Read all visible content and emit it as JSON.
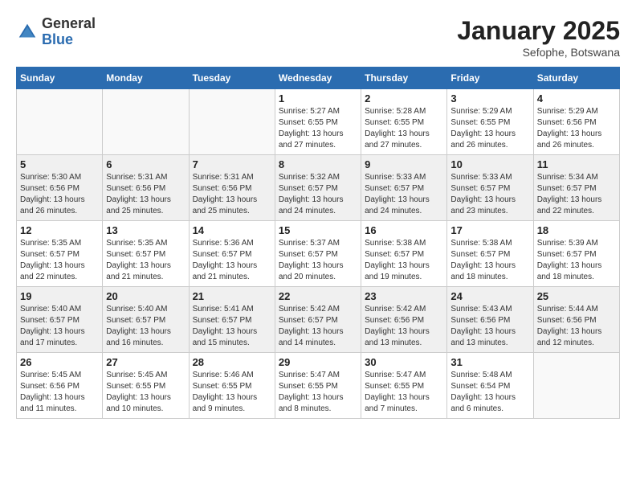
{
  "header": {
    "logo_general": "General",
    "logo_blue": "Blue",
    "month_title": "January 2025",
    "subtitle": "Sefophe, Botswana"
  },
  "weekdays": [
    "Sunday",
    "Monday",
    "Tuesday",
    "Wednesday",
    "Thursday",
    "Friday",
    "Saturday"
  ],
  "weeks": [
    [
      {
        "day": "",
        "info": ""
      },
      {
        "day": "",
        "info": ""
      },
      {
        "day": "",
        "info": ""
      },
      {
        "day": "1",
        "info": "Sunrise: 5:27 AM\nSunset: 6:55 PM\nDaylight: 13 hours\nand 27 minutes."
      },
      {
        "day": "2",
        "info": "Sunrise: 5:28 AM\nSunset: 6:55 PM\nDaylight: 13 hours\nand 27 minutes."
      },
      {
        "day": "3",
        "info": "Sunrise: 5:29 AM\nSunset: 6:55 PM\nDaylight: 13 hours\nand 26 minutes."
      },
      {
        "day": "4",
        "info": "Sunrise: 5:29 AM\nSunset: 6:56 PM\nDaylight: 13 hours\nand 26 minutes."
      }
    ],
    [
      {
        "day": "5",
        "info": "Sunrise: 5:30 AM\nSunset: 6:56 PM\nDaylight: 13 hours\nand 26 minutes."
      },
      {
        "day": "6",
        "info": "Sunrise: 5:31 AM\nSunset: 6:56 PM\nDaylight: 13 hours\nand 25 minutes."
      },
      {
        "day": "7",
        "info": "Sunrise: 5:31 AM\nSunset: 6:56 PM\nDaylight: 13 hours\nand 25 minutes."
      },
      {
        "day": "8",
        "info": "Sunrise: 5:32 AM\nSunset: 6:57 PM\nDaylight: 13 hours\nand 24 minutes."
      },
      {
        "day": "9",
        "info": "Sunrise: 5:33 AM\nSunset: 6:57 PM\nDaylight: 13 hours\nand 24 minutes."
      },
      {
        "day": "10",
        "info": "Sunrise: 5:33 AM\nSunset: 6:57 PM\nDaylight: 13 hours\nand 23 minutes."
      },
      {
        "day": "11",
        "info": "Sunrise: 5:34 AM\nSunset: 6:57 PM\nDaylight: 13 hours\nand 22 minutes."
      }
    ],
    [
      {
        "day": "12",
        "info": "Sunrise: 5:35 AM\nSunset: 6:57 PM\nDaylight: 13 hours\nand 22 minutes."
      },
      {
        "day": "13",
        "info": "Sunrise: 5:35 AM\nSunset: 6:57 PM\nDaylight: 13 hours\nand 21 minutes."
      },
      {
        "day": "14",
        "info": "Sunrise: 5:36 AM\nSunset: 6:57 PM\nDaylight: 13 hours\nand 21 minutes."
      },
      {
        "day": "15",
        "info": "Sunrise: 5:37 AM\nSunset: 6:57 PM\nDaylight: 13 hours\nand 20 minutes."
      },
      {
        "day": "16",
        "info": "Sunrise: 5:38 AM\nSunset: 6:57 PM\nDaylight: 13 hours\nand 19 minutes."
      },
      {
        "day": "17",
        "info": "Sunrise: 5:38 AM\nSunset: 6:57 PM\nDaylight: 13 hours\nand 18 minutes."
      },
      {
        "day": "18",
        "info": "Sunrise: 5:39 AM\nSunset: 6:57 PM\nDaylight: 13 hours\nand 18 minutes."
      }
    ],
    [
      {
        "day": "19",
        "info": "Sunrise: 5:40 AM\nSunset: 6:57 PM\nDaylight: 13 hours\nand 17 minutes."
      },
      {
        "day": "20",
        "info": "Sunrise: 5:40 AM\nSunset: 6:57 PM\nDaylight: 13 hours\nand 16 minutes."
      },
      {
        "day": "21",
        "info": "Sunrise: 5:41 AM\nSunset: 6:57 PM\nDaylight: 13 hours\nand 15 minutes."
      },
      {
        "day": "22",
        "info": "Sunrise: 5:42 AM\nSunset: 6:57 PM\nDaylight: 13 hours\nand 14 minutes."
      },
      {
        "day": "23",
        "info": "Sunrise: 5:42 AM\nSunset: 6:56 PM\nDaylight: 13 hours\nand 13 minutes."
      },
      {
        "day": "24",
        "info": "Sunrise: 5:43 AM\nSunset: 6:56 PM\nDaylight: 13 hours\nand 13 minutes."
      },
      {
        "day": "25",
        "info": "Sunrise: 5:44 AM\nSunset: 6:56 PM\nDaylight: 13 hours\nand 12 minutes."
      }
    ],
    [
      {
        "day": "26",
        "info": "Sunrise: 5:45 AM\nSunset: 6:56 PM\nDaylight: 13 hours\nand 11 minutes."
      },
      {
        "day": "27",
        "info": "Sunrise: 5:45 AM\nSunset: 6:55 PM\nDaylight: 13 hours\nand 10 minutes."
      },
      {
        "day": "28",
        "info": "Sunrise: 5:46 AM\nSunset: 6:55 PM\nDaylight: 13 hours\nand 9 minutes."
      },
      {
        "day": "29",
        "info": "Sunrise: 5:47 AM\nSunset: 6:55 PM\nDaylight: 13 hours\nand 8 minutes."
      },
      {
        "day": "30",
        "info": "Sunrise: 5:47 AM\nSunset: 6:55 PM\nDaylight: 13 hours\nand 7 minutes."
      },
      {
        "day": "31",
        "info": "Sunrise: 5:48 AM\nSunset: 6:54 PM\nDaylight: 13 hours\nand 6 minutes."
      },
      {
        "day": "",
        "info": ""
      }
    ]
  ]
}
